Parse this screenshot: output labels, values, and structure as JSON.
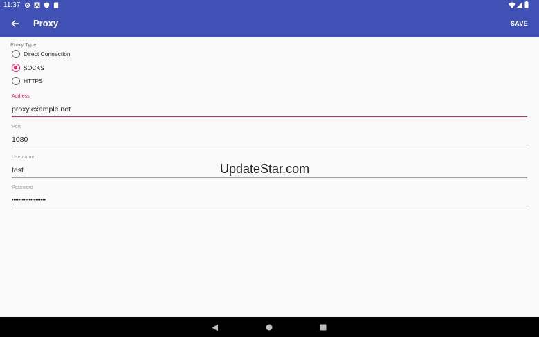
{
  "status_bar": {
    "time": "11:37",
    "left_icons": [
      "gear-icon",
      "a-icon",
      "shield-icon",
      "sd-card-icon"
    ],
    "right_icons": [
      "wifi-icon",
      "signal-icon",
      "battery-icon"
    ]
  },
  "app_bar": {
    "title": "Proxy",
    "save_label": "SAVE"
  },
  "proxy_type": {
    "label": "Proxy Type",
    "options": [
      {
        "label": "Direct Connection",
        "checked": false
      },
      {
        "label": "SOCKS",
        "checked": true
      },
      {
        "label": "HTTPS",
        "checked": false
      }
    ]
  },
  "fields": {
    "address": {
      "label": "Address",
      "value": "proxy.example.net"
    },
    "port": {
      "label": "Port",
      "value": "1080"
    },
    "username": {
      "label": "Username",
      "value": "test"
    },
    "password": {
      "label": "Password",
      "value": "••••••••••••••••••••"
    }
  },
  "watermark": "UpdateStar.com",
  "colors": {
    "primary": "#3f51b5",
    "accent": "#e91e63"
  }
}
